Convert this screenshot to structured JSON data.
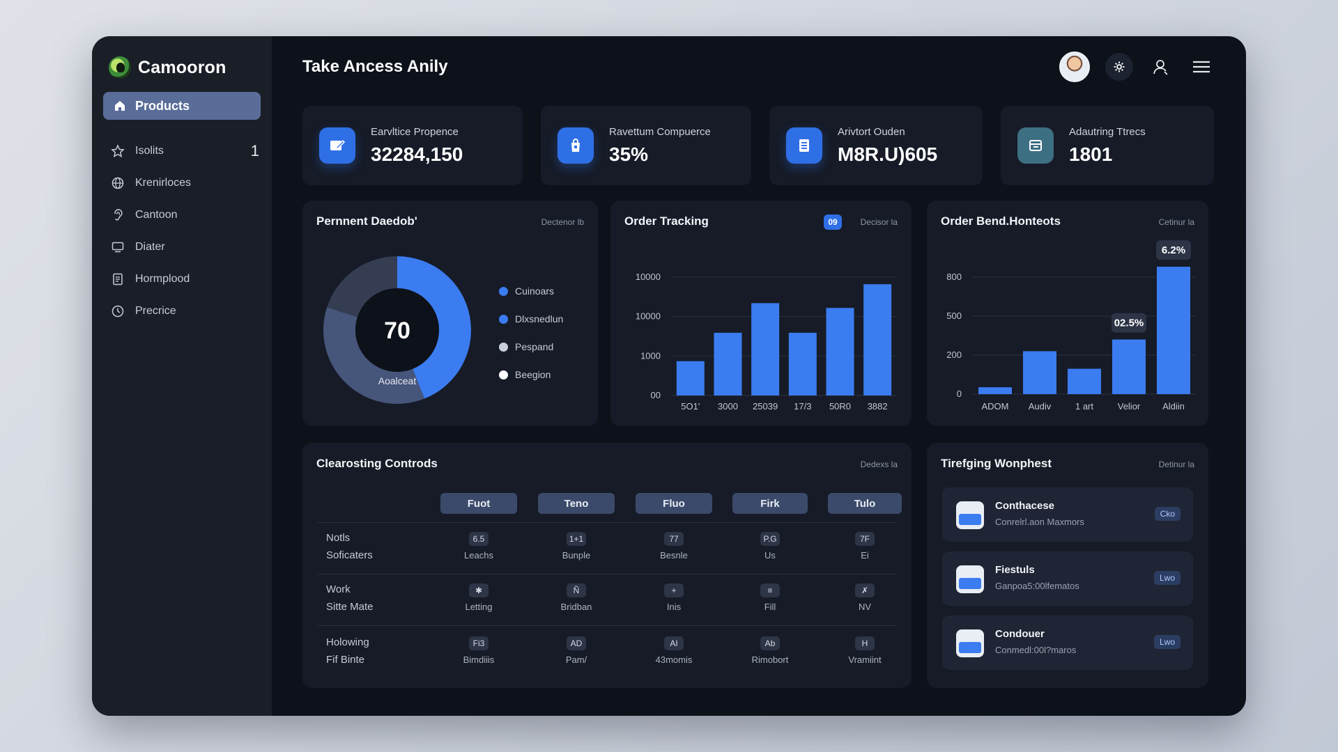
{
  "app": {
    "name": "Camooron"
  },
  "sidebar": {
    "active_item": "Products",
    "items": [
      {
        "label": "Isolits",
        "icon": "star-icon",
        "count": "1"
      },
      {
        "label": "Krenirloces",
        "icon": "globe-icon"
      },
      {
        "label": "Cantoon",
        "icon": "ear-icon"
      },
      {
        "label": "Diater",
        "icon": "monitor-icon"
      },
      {
        "label": "Hormplood",
        "icon": "document-icon"
      },
      {
        "label": "Precrice",
        "icon": "clock-icon"
      }
    ]
  },
  "header": {
    "title": "Take Ancess Anily"
  },
  "stats": [
    {
      "label": "Earvltice Propence",
      "value": "32284,150",
      "icon": "edit-icon"
    },
    {
      "label": "Ravettum Compuerce",
      "value": "35%",
      "icon": "bag-icon"
    },
    {
      "label": "Arivtort Ouden",
      "value": "M8R.U)605",
      "icon": "list-icon"
    },
    {
      "label": "Adautring Ttrecs",
      "value": "1801",
      "icon": "folder-icon"
    }
  ],
  "donut_panel": {
    "title": "Pernnent Daedob'",
    "link": "Dectenor lb",
    "center_value": "70",
    "center_label": "Aoalceat",
    "legend": [
      {
        "label": "Cuinoars",
        "color": "#3b7cf0"
      },
      {
        "label": "Dlxsnedlun",
        "color": "#3b7cf0"
      },
      {
        "label": "Pespand",
        "color": "#c9cfdb"
      },
      {
        "label": "Beegion",
        "color": "#ffffff"
      }
    ]
  },
  "order_tracking": {
    "title": "Order Tracking",
    "badge": "09",
    "link": "Decisor la"
  },
  "order_bend": {
    "title": "Order Bend.Honteots",
    "link": "Cetinur la"
  },
  "chart_data": [
    {
      "type": "donut",
      "values": [
        44,
        36,
        20
      ],
      "colors": [
        "#3b7cf0",
        "#46557a",
        "#343d52"
      ],
      "center_value": "70"
    },
    {
      "type": "bar",
      "title": "Order Tracking",
      "categories": [
        "5O1'",
        "3000",
        "25039",
        "17/3",
        "50R0",
        "3882"
      ],
      "yticks": [
        "00",
        "1000",
        "10000",
        "10000"
      ],
      "values": [
        0.29,
        0.53,
        0.78,
        0.53,
        0.74,
        0.94
      ]
    },
    {
      "type": "bar",
      "title": "Order Bend.Honteots",
      "categories": [
        "ADOM",
        "Audiv",
        "1 art",
        "Velior",
        "Aldiin"
      ],
      "yticks": [
        "0",
        "200",
        "500",
        "800"
      ],
      "values": [
        35,
        230,
        130,
        320,
        880
      ],
      "ylim": [
        0,
        900
      ],
      "annotations": [
        {
          "category": "Velior",
          "label": "02.5%"
        },
        {
          "category": "Aldiin",
          "label": "6.2%"
        }
      ]
    }
  ],
  "table_panel": {
    "title": "Clearosting Controds",
    "link": "Dedexs la",
    "columns": [
      "Fuot",
      "Teno",
      "Fluo",
      "Firk",
      "Tulo"
    ],
    "rows": [
      {
        "label1": "Notls",
        "label2": "Soficaters",
        "cells": [
          {
            "chip": "6.5",
            "sub": "Leachs"
          },
          {
            "chip": "1+1",
            "sub": "Bunple"
          },
          {
            "chip": "77",
            "sub": "Besnle"
          },
          {
            "chip": "P.G",
            "sub": "Us"
          },
          {
            "chip": "7F",
            "sub": "Ei"
          }
        ]
      },
      {
        "label1": "Work",
        "label2": "Sitte Mate",
        "cells": [
          {
            "chip": "✱",
            "sub": "Letting"
          },
          {
            "chip": "Ñ",
            "sub": "Bridban"
          },
          {
            "chip": "+",
            "sub": "Inis"
          },
          {
            "chip": "≡",
            "sub": "Fill"
          },
          {
            "chip": "✗",
            "sub": "NV"
          }
        ]
      },
      {
        "label1": "Holowing",
        "label2": "Fif Binte",
        "cells": [
          {
            "chip": "Fi3",
            "sub": "Bimdiiis"
          },
          {
            "chip": "AD",
            "sub": "Pam/"
          },
          {
            "chip": "AI",
            "sub": "43momis"
          },
          {
            "chip": "Ab",
            "sub": "Rimobort"
          },
          {
            "chip": "H",
            "sub": "Vramiint"
          }
        ]
      }
    ]
  },
  "notifications_panel": {
    "title": "Tirefging Wonphest",
    "link": "Detinur la",
    "items": [
      {
        "title": "Conthacese",
        "sub": "Conrelrl.aon Maxmors",
        "badge": "Cko"
      },
      {
        "title": "Fiestuls",
        "sub": "Ganpoa5:00lfematos",
        "badge": "Lwo"
      },
      {
        "title": "Condouer",
        "sub": "Conmedl:00l?maros",
        "badge": "Lwo"
      }
    ]
  },
  "colors": {
    "accent": "#3b7cf0",
    "background": "#0d111a",
    "panel": "#161b27",
    "sidebar": "#1a1e27"
  }
}
